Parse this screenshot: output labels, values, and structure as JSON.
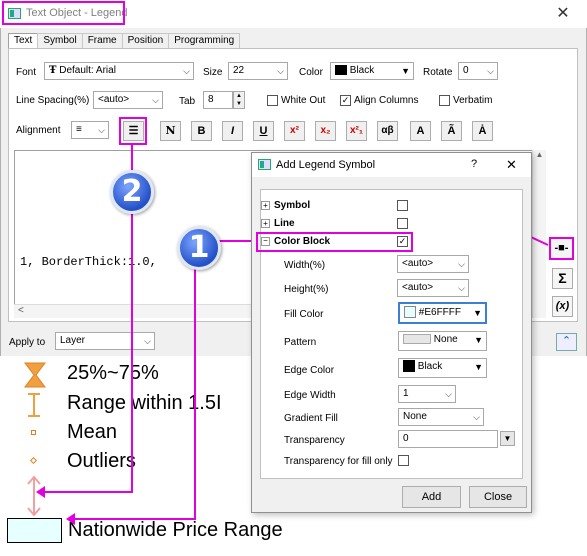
{
  "window": {
    "title": "Text Object - Legend"
  },
  "tabs": [
    "Text",
    "Symbol",
    "Frame",
    "Position",
    "Programming"
  ],
  "format": {
    "font_label": "Font",
    "font_value": "Default: Arial",
    "size_label": "Size",
    "size_value": "22",
    "color_label": "Color",
    "color_value": "Black",
    "rotate_label": "Rotate",
    "rotate_value": "0",
    "line_spacing_label": "Line Spacing(%)",
    "line_spacing_value": "<auto>",
    "tab_label": "Tab",
    "tab_value": "8",
    "white_out": "White Out",
    "align_columns": "Align Columns",
    "verbatim": "Verbatim",
    "alignment_label": "Alignment",
    "buttons": [
      "N",
      "B",
      "I",
      "U",
      "x²",
      "x₂",
      "x²₁",
      "αβ",
      "A",
      "Ã",
      "Ȧ"
    ]
  },
  "editor": {
    "text": "1, BorderThick:1.0,"
  },
  "apply_to": {
    "label": "Apply to",
    "value": "Layer"
  },
  "legend_preview": {
    "items": [
      "25%~75%",
      "Range within 1.5I",
      "Mean",
      "Outliers"
    ],
    "last": "Nationwide Price Range"
  },
  "dialog": {
    "title": "Add Legend Symbol",
    "help": "?",
    "close": "✕",
    "tree": [
      "Symbol",
      "Line",
      "Color Block"
    ],
    "rows": [
      {
        "label": "Width(%)",
        "value": "<auto>"
      },
      {
        "label": "Height(%)",
        "value": "<auto>"
      },
      {
        "label": "Fill Color",
        "value": "#E6FFFF"
      },
      {
        "label": "Pattern",
        "value": "None"
      },
      {
        "label": "Edge Color",
        "value": "Black"
      },
      {
        "label": "Edge Width",
        "value": "1"
      },
      {
        "label": "Gradient Fill",
        "value": "None"
      },
      {
        "label": "Transparency",
        "value": "0"
      },
      {
        "label": "Transparency for fill only",
        "value": ""
      }
    ],
    "add": "Add",
    "close_btn": "Close"
  },
  "callouts": {
    "one": "1",
    "two": "2"
  },
  "colors": {
    "accent": "#e000e0",
    "fill": "#E6FFFF",
    "badge": "#2450c8"
  }
}
